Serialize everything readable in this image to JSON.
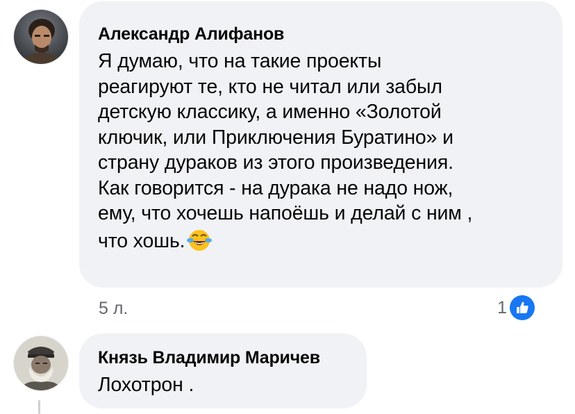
{
  "comments": [
    {
      "author": "Александр Алифанов",
      "text_lines": [
        "Я думаю, что на такие проекты",
        "реагируют те, кто не читал или забыл",
        "детскую классику, а именно «Золотой",
        "ключик, или Приключения Буратино» и",
        "страну дураков из этого произведения.",
        "Как говорится - на дурака не надо нож,",
        "ему, что хочешь напоёшь и делай с ним ,",
        "что хошь."
      ],
      "emoji": "face-with-tears-of-joy",
      "time": "5 л.",
      "reaction_count": "1",
      "reaction_icon": "like-icon"
    },
    {
      "author": "Князь Владимир Маричев",
      "text_lines": [
        "Лохотрон ."
      ]
    }
  ],
  "colors": {
    "bubble_bg": "#f0f2f5",
    "meta_text": "#65676b",
    "like_blue": "#1877f2"
  }
}
